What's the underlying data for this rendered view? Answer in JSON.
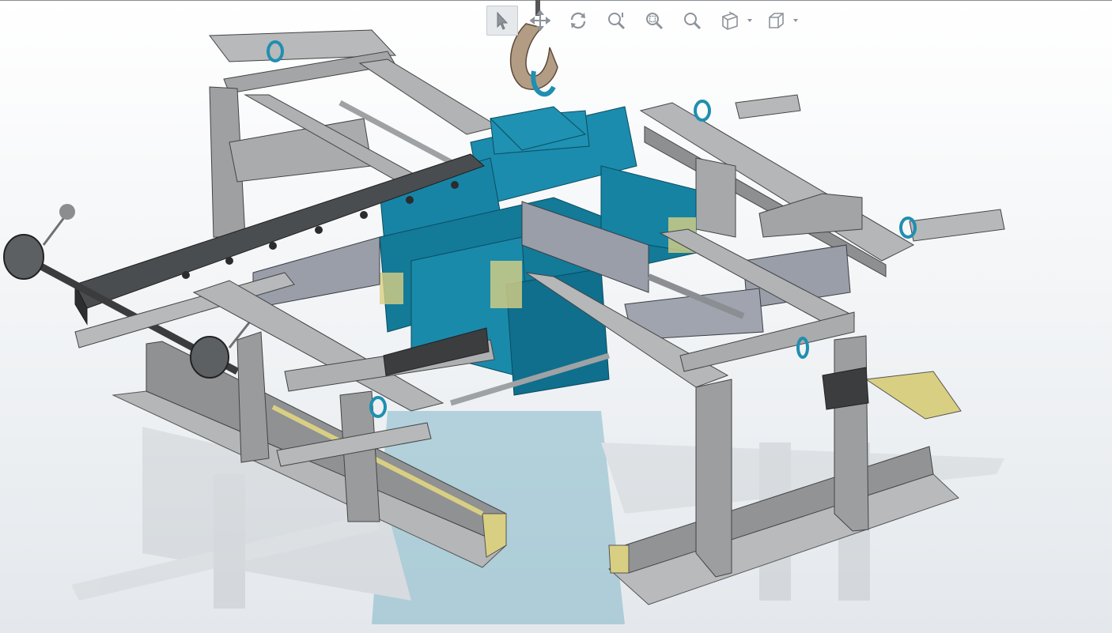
{
  "app": {
    "kind": "3D CAD model viewer"
  },
  "toolbar": {
    "buttons": [
      {
        "name": "select-tool",
        "icon": "cursor-arrow-icon",
        "active": true
      },
      {
        "name": "pan-tool",
        "icon": "pan-arrows-icon",
        "active": false
      },
      {
        "name": "rotate-tool",
        "icon": "rotate-icon",
        "active": false
      },
      {
        "name": "zoom-tool",
        "icon": "zoom-icon",
        "active": false
      },
      {
        "name": "zoom-to-fit",
        "icon": "zoom-fit-icon",
        "active": false
      },
      {
        "name": "zoom-area",
        "icon": "zoom-area-icon",
        "active": false
      },
      {
        "name": "view-orientation",
        "icon": "view-orientation-icon",
        "active": false,
        "has_dropdown": true
      },
      {
        "name": "display-style",
        "icon": "display-cube-icon",
        "active": false,
        "has_dropdown": true
      }
    ]
  },
  "colors": {
    "background_top": "#ffffff",
    "background_bottom": "#e4e8ec",
    "frame_gray": "#a7a9ab",
    "frame_dark": "#7d8082",
    "teal_body": "#1f8fb0",
    "teal_dark": "#0e6a86",
    "beam_dark": "#3f4244",
    "pad_yellow": "#d7cf8a",
    "hook_tan": "#b39c84",
    "icon_gray": "#8d939a"
  }
}
